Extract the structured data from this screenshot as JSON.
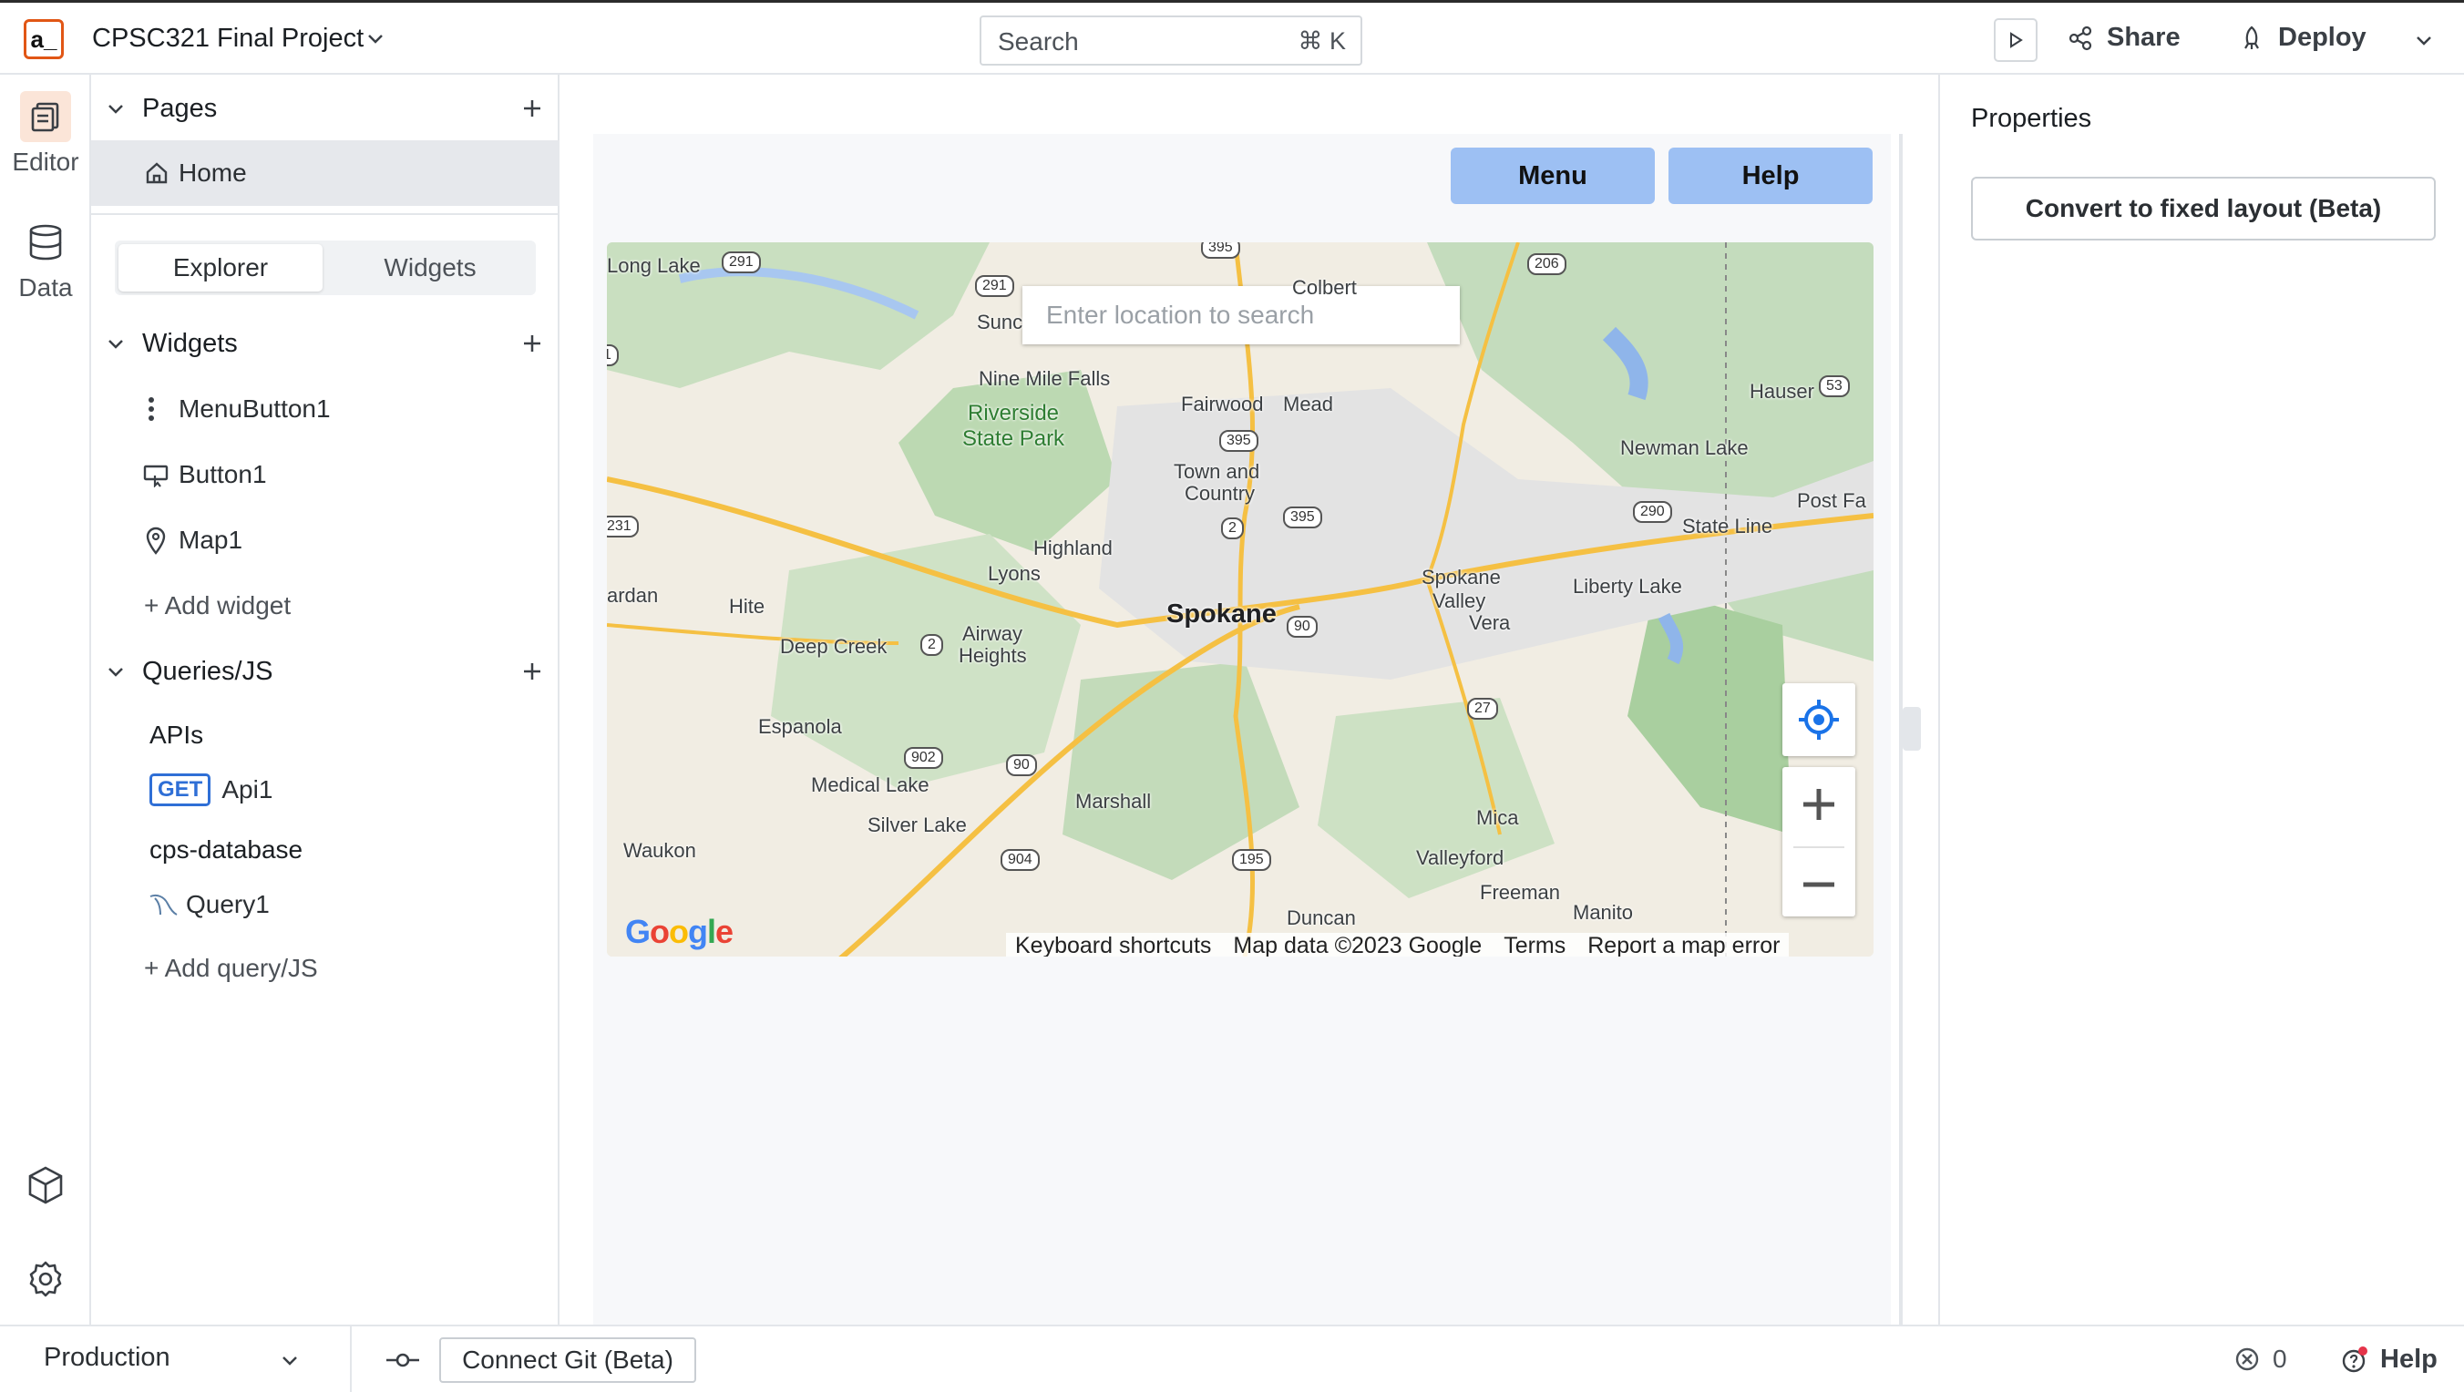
{
  "header": {
    "logo_text": "a_",
    "app_title": "CPSC321 Final Project",
    "search_label": "Search",
    "search_shortcut": "⌘ K",
    "share_label": "Share",
    "deploy_label": "Deploy"
  },
  "rail": {
    "editor_label": "Editor",
    "data_label": "Data"
  },
  "explorer": {
    "pages_header": "Pages",
    "home_page": "Home",
    "tab_explorer": "Explorer",
    "tab_widgets": "Widgets",
    "widgets_header": "Widgets",
    "widgets": [
      "MenuButton1",
      "Button1",
      "Map1"
    ],
    "add_widget": "+ Add widget",
    "queries_header": "Queries/JS",
    "apis_header": "APIs",
    "api_method": "GET",
    "api_name": "Api1",
    "datasource_header": "cps-database",
    "query_name": "Query1",
    "add_query": "+ Add query/JS"
  },
  "canvas": {
    "menu_button": "Menu",
    "help_button": "Help",
    "map": {
      "search_placeholder": "Enter location to search",
      "places": {
        "long_lake": "Long Lake",
        "sun": "Sunc",
        "colbert": "Colbert",
        "nine_mile_falls": "Nine Mile Falls",
        "riverside": "Riverside",
        "state_park": "State Park",
        "fairwood": "Fairwood",
        "mead": "Mead",
        "hauser": "Hauser",
        "town_and": "Town and",
        "country": "Country",
        "newman_lake": "Newman Lake",
        "post_falls": "Post Fa",
        "state_line": "State Line",
        "highland": "Highland",
        "lyons": "Lyons",
        "spokane_valley_1": "Spokane",
        "spokane_valley_2": "Valley",
        "liberty_lake": "Liberty Lake",
        "ardan": "ardan",
        "hite": "Hite",
        "spokane": "Spokane",
        "vera": "Vera",
        "deep_creek": "Deep Creek",
        "airway_1": "Airway",
        "airway_2": "Heights",
        "espanola": "Espanola",
        "medical_lake": "Medical Lake",
        "marshall": "Marshall",
        "silver_lake": "Silver Lake",
        "mica": "Mica",
        "waukon": "Waukon",
        "valleyford": "Valleyford",
        "freeman": "Freeman",
        "duncan": "Duncan",
        "manito": "Manito"
      },
      "shields": {
        "s291": "291",
        "s291b": "291",
        "s395top": "395",
        "s206": "206",
        "s53": "53",
        "s395": "395",
        "s395b": "395",
        "s2": "2",
        "s290": "290",
        "s231": "231",
        "s2b": "2",
        "s90": "90",
        "s902": "902",
        "s90b": "90",
        "s27": "27",
        "s904": "904",
        "s195": "195",
        "s1": "1"
      },
      "google_logo": "Google",
      "footer": {
        "shortcuts": "Keyboard shortcuts",
        "mapdata": "Map data ©2023 Google",
        "terms": "Terms",
        "report": "Report a map error"
      }
    }
  },
  "properties": {
    "title": "Properties",
    "convert_button": "Convert to fixed layout (Beta)"
  },
  "bottombar": {
    "environment": "Production",
    "connect_git": "Connect Git (Beta)",
    "error_count": "0",
    "help_label": "Help"
  },
  "colors": {
    "accent": "#e15615",
    "widget_button": "#9dc0f3",
    "get_badge": "#2f6fd6"
  }
}
